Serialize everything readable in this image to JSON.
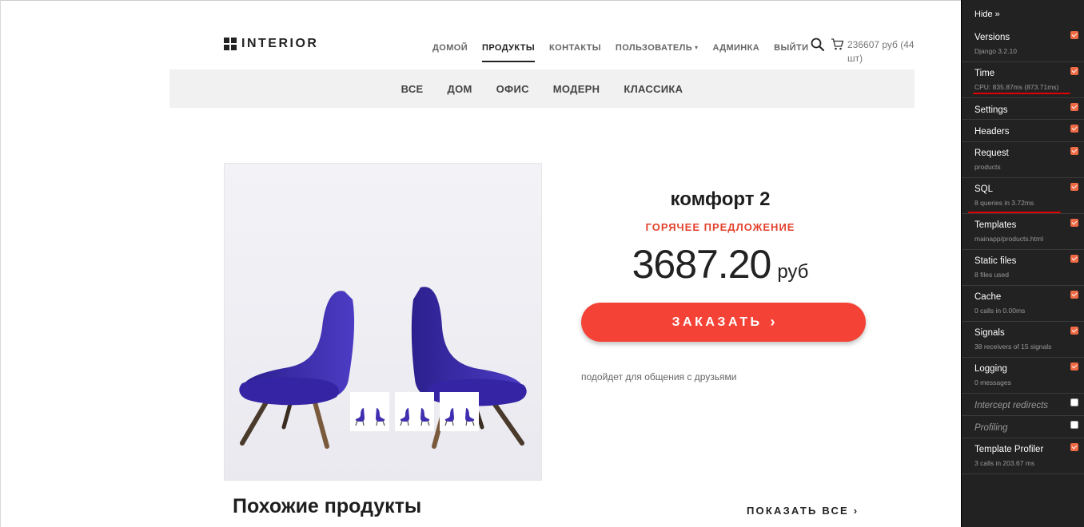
{
  "site": {
    "logo_text": "INTERIOR",
    "nav": [
      {
        "label": "ДОМОЙ",
        "active": false
      },
      {
        "label": "ПРОДУКТЫ",
        "active": true
      },
      {
        "label": "КОНТАКТЫ",
        "active": false
      },
      {
        "label": "ПОЛЬЗОВАТЕЛЬ",
        "active": false,
        "caret": "▾"
      },
      {
        "label": "АДМИНКА",
        "active": false
      },
      {
        "label": "ВЫЙТИ",
        "active": false
      }
    ],
    "cart_total": "236607 руб (44 шт)",
    "categories": [
      "ВСЕ",
      "ДОМ",
      "ОФИС",
      "МОДЕРН",
      "КЛАССИКА"
    ]
  },
  "product": {
    "name": "комфорт 2",
    "badge": "ГОРЯЧЕЕ ПРЕДЛОЖЕНИЕ",
    "price": "3687.20",
    "currency": "руб",
    "order_label": "ЗАКАЗАТЬ",
    "order_arrow": "›",
    "description": "подойдет для общения с друзьями",
    "chair_color": "#3f2fb0",
    "thumbnail_count": 3
  },
  "similar": {
    "title": "Похожие продукты",
    "show_all": "ПОКАЗАТЬ ВСЕ",
    "arrow": "›"
  },
  "debug_toolbar": {
    "hide_label": "Hide »",
    "panels": [
      {
        "title": "Versions",
        "subtitle": "Django 3.2.10",
        "checked": true
      },
      {
        "title": "Time",
        "subtitle": "CPU: 835.87ms (873.71ms)",
        "checked": true
      },
      {
        "title": "Settings",
        "subtitle": "",
        "checked": true
      },
      {
        "title": "Headers",
        "subtitle": "",
        "checked": true
      },
      {
        "title": "Request",
        "subtitle": "products",
        "checked": true
      },
      {
        "title": "SQL",
        "subtitle": "8 queries in 3.72ms",
        "checked": true
      },
      {
        "title": "Templates",
        "subtitle": "mainapp/products.html",
        "checked": true
      },
      {
        "title": "Static files",
        "subtitle": "8 files used",
        "checked": true
      },
      {
        "title": "Cache",
        "subtitle": "0 calls in 0.00ms",
        "checked": true
      },
      {
        "title": "Signals",
        "subtitle": "38 receivers of 15 signals",
        "checked": true
      },
      {
        "title": "Logging",
        "subtitle": "0 messages",
        "checked": true
      },
      {
        "title": "Intercept redirects",
        "subtitle": "",
        "checked": false
      },
      {
        "title": "Profiling",
        "subtitle": "",
        "checked": false
      },
      {
        "title": "Template Profiler",
        "subtitle": "3 calls in 203.67 ms",
        "checked": true
      }
    ],
    "accent_color": "#ee6a44",
    "highlight_color": "#e00000"
  }
}
